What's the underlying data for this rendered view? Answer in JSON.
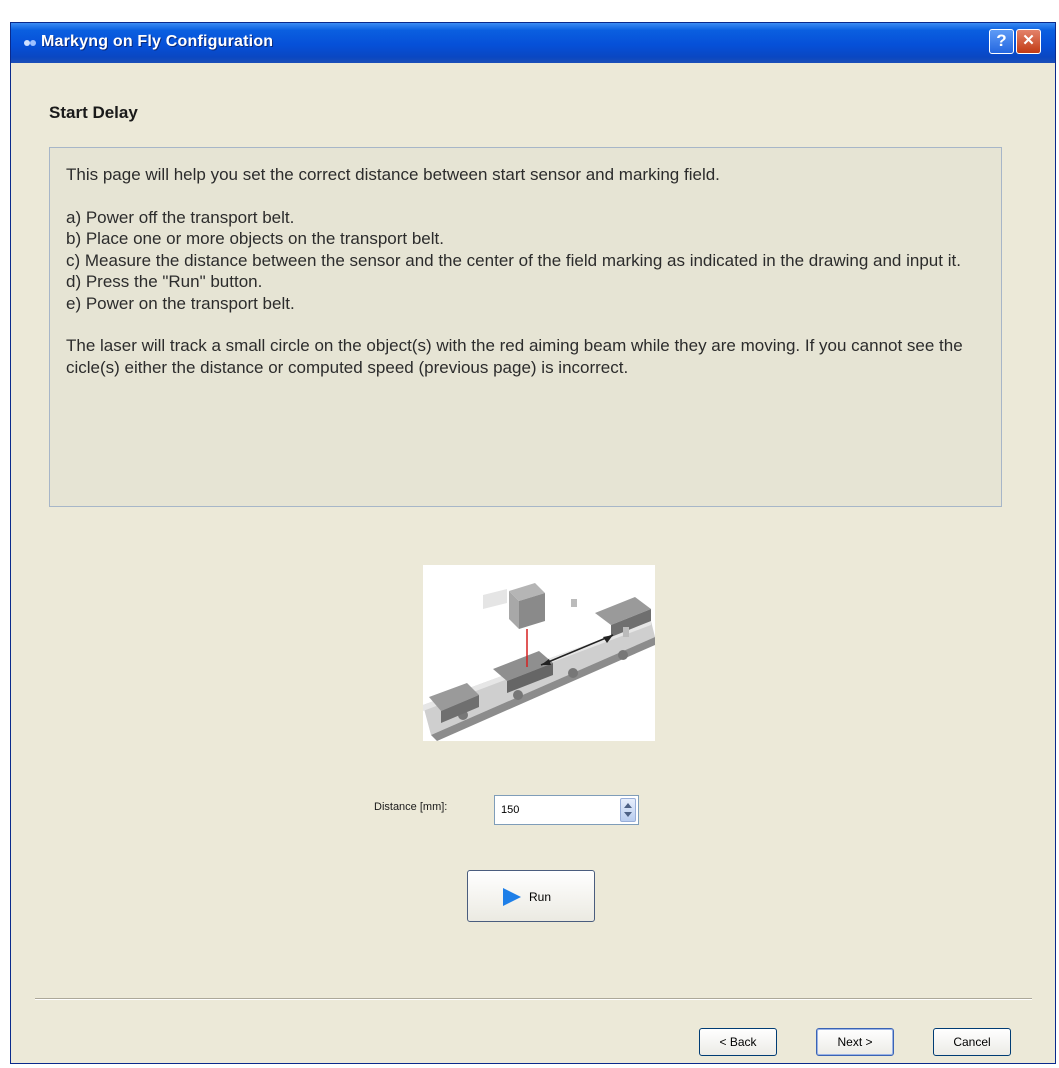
{
  "window": {
    "title": "Markyng on Fly Configuration",
    "help_button": "?",
    "close_button": "✕"
  },
  "page": {
    "heading": "Start Delay",
    "intro": "This page will help you set the correct distance between start sensor and marking field.",
    "steps": [
      "a) Power off the transport belt.",
      "b) Place one or more objects on the transport belt.",
      "c) Measure the distance between the sensor and the center of the field marking as indicated in the drawing and input it.",
      "d) Press the \"Run\" button.",
      "e) Power on the transport belt."
    ],
    "note": "The laser will track a small circle on the object(s) with the red aiming beam while they are moving. If you cannot see the cicle(s) either the distance or computed speed (previous page) is incorrect."
  },
  "distance": {
    "label": "Distance [mm]:",
    "value": "150"
  },
  "run_button": {
    "label": "Run"
  },
  "footer": {
    "back_label": "< Back",
    "next_label": "Next >",
    "cancel_label": "Cancel"
  },
  "colors": {
    "title_bar": "#0650d8",
    "window_background": "#ece9d8",
    "run_icon": "#1e7fe8",
    "aiming_beam": "#d62020"
  },
  "icons": {
    "app": "laser-app-icon",
    "help": "help-icon",
    "close": "close-icon",
    "run": "play-icon",
    "spinner": "spinner-arrows-icon"
  }
}
